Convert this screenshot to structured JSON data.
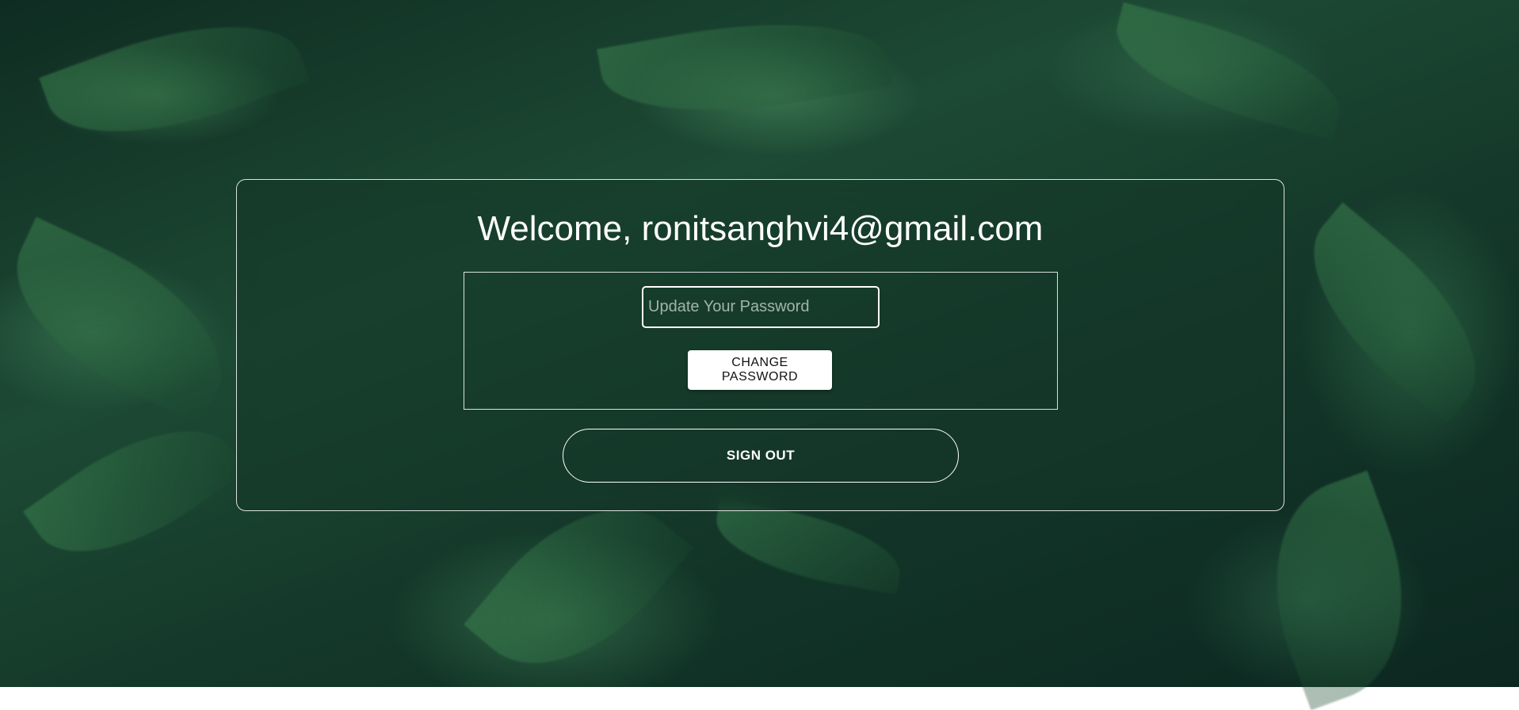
{
  "welcome": {
    "text": "Welcome, ronitsanghvi4@gmail.com"
  },
  "password_form": {
    "placeholder": "Update Your Password",
    "value": "",
    "change_label": "CHANGE PASSWORD"
  },
  "signout": {
    "label": "SIGN OUT"
  },
  "colors": {
    "background_dark": "#0f2c22",
    "background_green": "#1d4a34",
    "text": "#ffffff",
    "button_bg": "#ffffff",
    "button_text": "#111111"
  }
}
